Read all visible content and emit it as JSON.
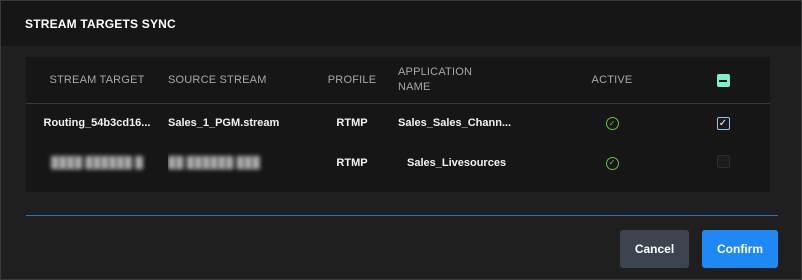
{
  "dialog": {
    "title": "STREAM TARGETS SYNC"
  },
  "table": {
    "columns": [
      "STREAM TARGET",
      "SOURCE STREAM",
      "PROFILE",
      "APPLICATION NAME",
      "ACTIVE"
    ],
    "header_checkbox_state": "indeterminate",
    "rows": [
      {
        "stream_target": "Routing_54b3cd16...",
        "source_stream": "Sales_1_PGM.stream",
        "profile": "RTMP",
        "application_name": "Sales_Sales_Chann...",
        "active": true,
        "selected": true,
        "redacted": false
      },
      {
        "stream_target": "",
        "source_stream": "",
        "profile": "RTMP",
        "application_name": "Sales_Livesources",
        "active": true,
        "selected": false,
        "redacted": true
      }
    ]
  },
  "footer": {
    "cancel_label": "Cancel",
    "confirm_label": "Confirm"
  },
  "colors": {
    "accent": "#1e88f5",
    "active_check": "#6dbf3e",
    "header_checkbox": "#7ef0c7",
    "divider": "#2a74c6"
  }
}
